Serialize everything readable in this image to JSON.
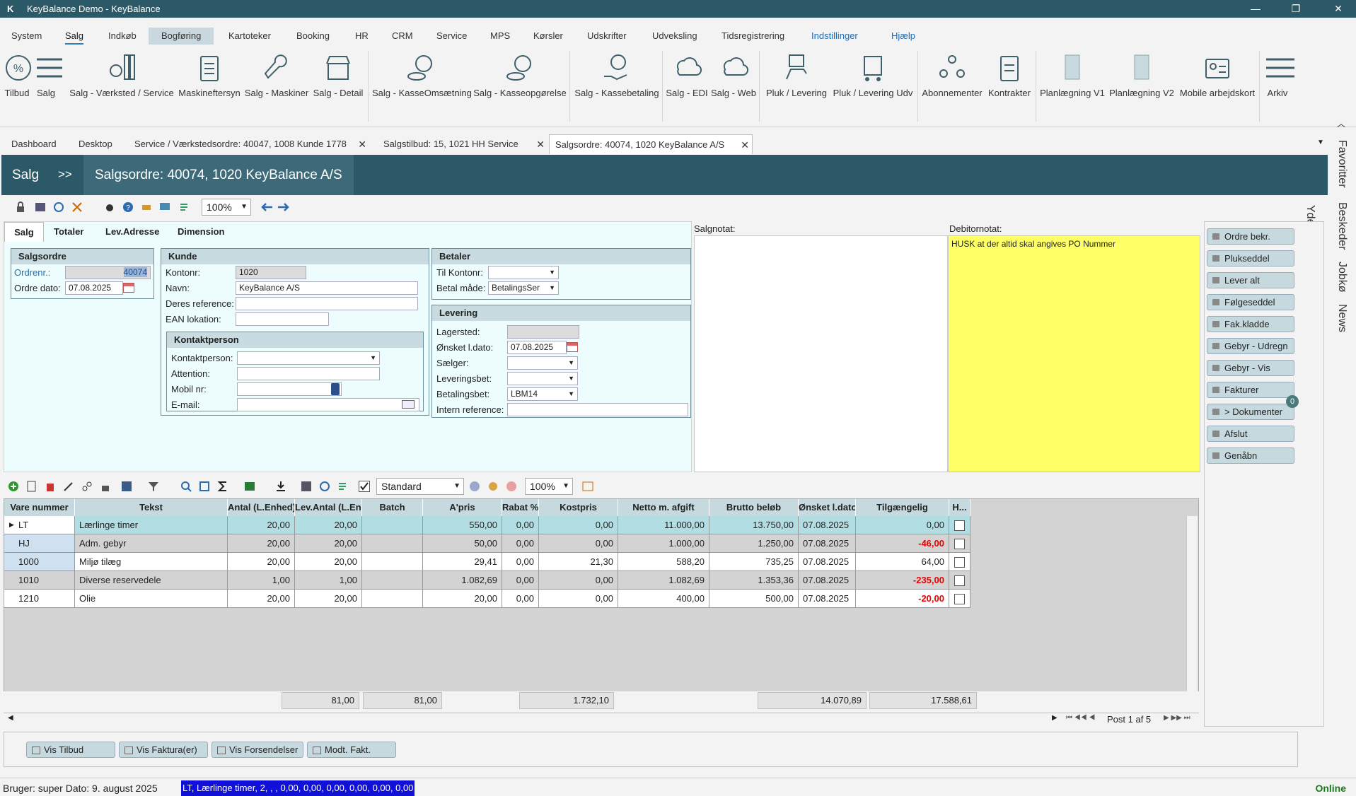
{
  "window": {
    "title": "KeyBalance Demo - KeyBalance",
    "logo": "K"
  },
  "menu": [
    "System",
    "Salg",
    "Indkøb",
    "Bogføring",
    "Kartoteker",
    "Booking",
    "HR",
    "CRM",
    "Service",
    "MPS",
    "Kørsler",
    "Udskrifter",
    "Udveksling",
    "Tidsregistrering",
    "Indstillinger",
    "Hjælp"
  ],
  "ribbon": [
    "Tilbud",
    "Salg",
    "Salg - Værksted / Service",
    "Maskineftersyn",
    "Salg - Maskiner",
    "Salg - Detail",
    "Salg - KasseOmsætning",
    "Salg - Kasseopgørelse",
    "Salg - Kassebetaling",
    "Salg - EDI",
    "Salg - Web",
    "Pluk / Levering",
    "Pluk / Levering Udv",
    "Abonnementer",
    "Kontrakter",
    "Planlægning V1",
    "Planlægning V2",
    "Mobile arbejdskort",
    "Arkiv"
  ],
  "tabs": [
    "Dashboard",
    "Desktop",
    "Service / Værkstedsordre: 40047, 1008 Kunde 1778",
    "Salgstilbud: 15, 1021 HH Service",
    "Salgsordre: 40074, 1020 KeyBalance A/S"
  ],
  "header": {
    "crumb1": "Salg",
    "sep": ">>",
    "title": "Salgsordre: 40074, 1020 KeyBalance A/S"
  },
  "side": [
    "Favoritter",
    "Beskeder",
    "Jobkø",
    "News"
  ],
  "side2": "Yderlige funktioner",
  "toolbar": {
    "zoom": "100%"
  },
  "form": {
    "subtabs": [
      "Salg",
      "Totaler",
      "Lev.Adresse",
      "Dimension"
    ],
    "salgsordre": {
      "title": "Salgsordre",
      "ordrenr_label": "Ordrenr.:",
      "ordrenr": "40074",
      "dato_label": "Ordre dato:",
      "dato": "07.08.2025"
    },
    "kunde": {
      "title": "Kunde",
      "kontonr_label": "Kontonr:",
      "kontonr": "1020",
      "navn_label": "Navn:",
      "navn": "KeyBalance A/S",
      "ref_label": "Deres reference:",
      "ref": "",
      "ean_label": "EAN lokation:",
      "ean": ""
    },
    "kontakt": {
      "title": "Kontaktperson",
      "kp_label": "Kontaktperson:",
      "att_label": "Attention:",
      "mobil_label": "Mobil nr:",
      "email_label": "E-mail:"
    },
    "betaler": {
      "title": "Betaler",
      "tilkonto_label": "Til Kontonr:",
      "tilkonto": "",
      "betalmaade_label": "Betal måde:",
      "betalmaade": "BetalingsSer"
    },
    "levering": {
      "title": "Levering",
      "lager_label": "Lagersted:",
      "dato_label": "Ønsket l.dato:",
      "dato": "07.08.2025",
      "saelger_label": "Sælger:",
      "levbet_label": "Leveringsbet:",
      "betbet_label": "Betalingsbet:",
      "betbet": "LBM14",
      "intref_label": "Intern reference:"
    }
  },
  "notes": {
    "salgnotat_label": "Salgnotat:",
    "debitor_label": "Debitornotat:",
    "debitor_text": "HUSK at der altid skal angives PO Nummer"
  },
  "side_buttons": [
    "Ordre bekr.",
    "Plukseddel",
    "Lever alt",
    "Følgeseddel",
    "Fak.kladde",
    "Gebyr - Udregn",
    "Gebyr - Vis",
    "Fakturer",
    "> Dokumenter",
    "Afslut",
    "Genåbn"
  ],
  "doc_badge": "0",
  "grid_toolbar": {
    "layout": "Standard",
    "zoom": "100%"
  },
  "grid": {
    "columns": [
      "Vare nummer",
      "Tekst",
      "Antal (L.Enhed)",
      "Lev.Antal (L.En...",
      "Batch",
      "A'pris",
      "Rabat %",
      "Kostpris",
      "Netto m. afgift",
      "Brutto beløb",
      "Ønsket l.dato",
      "Tilgængelig",
      "H..."
    ],
    "rows": [
      {
        "vare": "LT",
        "tekst": "Lærlinge timer",
        "antal": "20,00",
        "levantal": "20,00",
        "batch": "",
        "apris": "550,00",
        "rabat": "0,00",
        "kost": "0,00",
        "netto": "11.000,00",
        "brutto": "13.750,00",
        "dato": "07.08.2025",
        "tilg": "0,00"
      },
      {
        "vare": "HJ",
        "tekst": "Adm. gebyr",
        "antal": "20,00",
        "levantal": "20,00",
        "batch": "",
        "apris": "50,00",
        "rabat": "0,00",
        "kost": "0,00",
        "netto": "1.000,00",
        "brutto": "1.250,00",
        "dato": "07.08.2025",
        "tilg": "-46,00"
      },
      {
        "vare": "1000",
        "tekst": "Miljø tilæg",
        "antal": "20,00",
        "levantal": "20,00",
        "batch": "",
        "apris": "29,41",
        "rabat": "0,00",
        "kost": "21,30",
        "netto": "588,20",
        "brutto": "735,25",
        "dato": "07.08.2025",
        "tilg": "64,00"
      },
      {
        "vare": "1010",
        "tekst": "Diverse reservedele",
        "antal": "1,00",
        "levantal": "1,00",
        "batch": "",
        "apris": "1.082,69",
        "rabat": "0,00",
        "kost": "0,00",
        "netto": "1.082,69",
        "brutto": "1.353,36",
        "dato": "07.08.2025",
        "tilg": "-235,00"
      },
      {
        "vare": "1210",
        "tekst": "Olie",
        "antal": "20,00",
        "levantal": "20,00",
        "batch": "",
        "apris": "20,00",
        "rabat": "0,00",
        "kost": "0,00",
        "netto": "400,00",
        "brutto": "500,00",
        "dato": "07.08.2025",
        "tilg": "-20,00"
      }
    ],
    "totals": {
      "antal": "81,00",
      "levantal": "81,00",
      "apris": "1.732,10",
      "netto": "14.070,89",
      "brutto": "17.588,61"
    },
    "pager": "Post 1 af 5"
  },
  "bottom_buttons": [
    "Vis Tilbud",
    "Vis Faktura(er)",
    "Vis Forsendelser",
    "Modt. Fakt."
  ],
  "status": {
    "user": "Bruger: super  Dato: 9. august 2025",
    "line": "LT, Lærlinge timer, 2, , , 0,00, 0,00, 0,00, 0,00, 0,00, 0,00",
    "online": "Online"
  },
  "colors": {
    "header": "#2c5968",
    "negative": "#ee0000",
    "note": "#ffff66",
    "online": "#1a7a1a"
  }
}
